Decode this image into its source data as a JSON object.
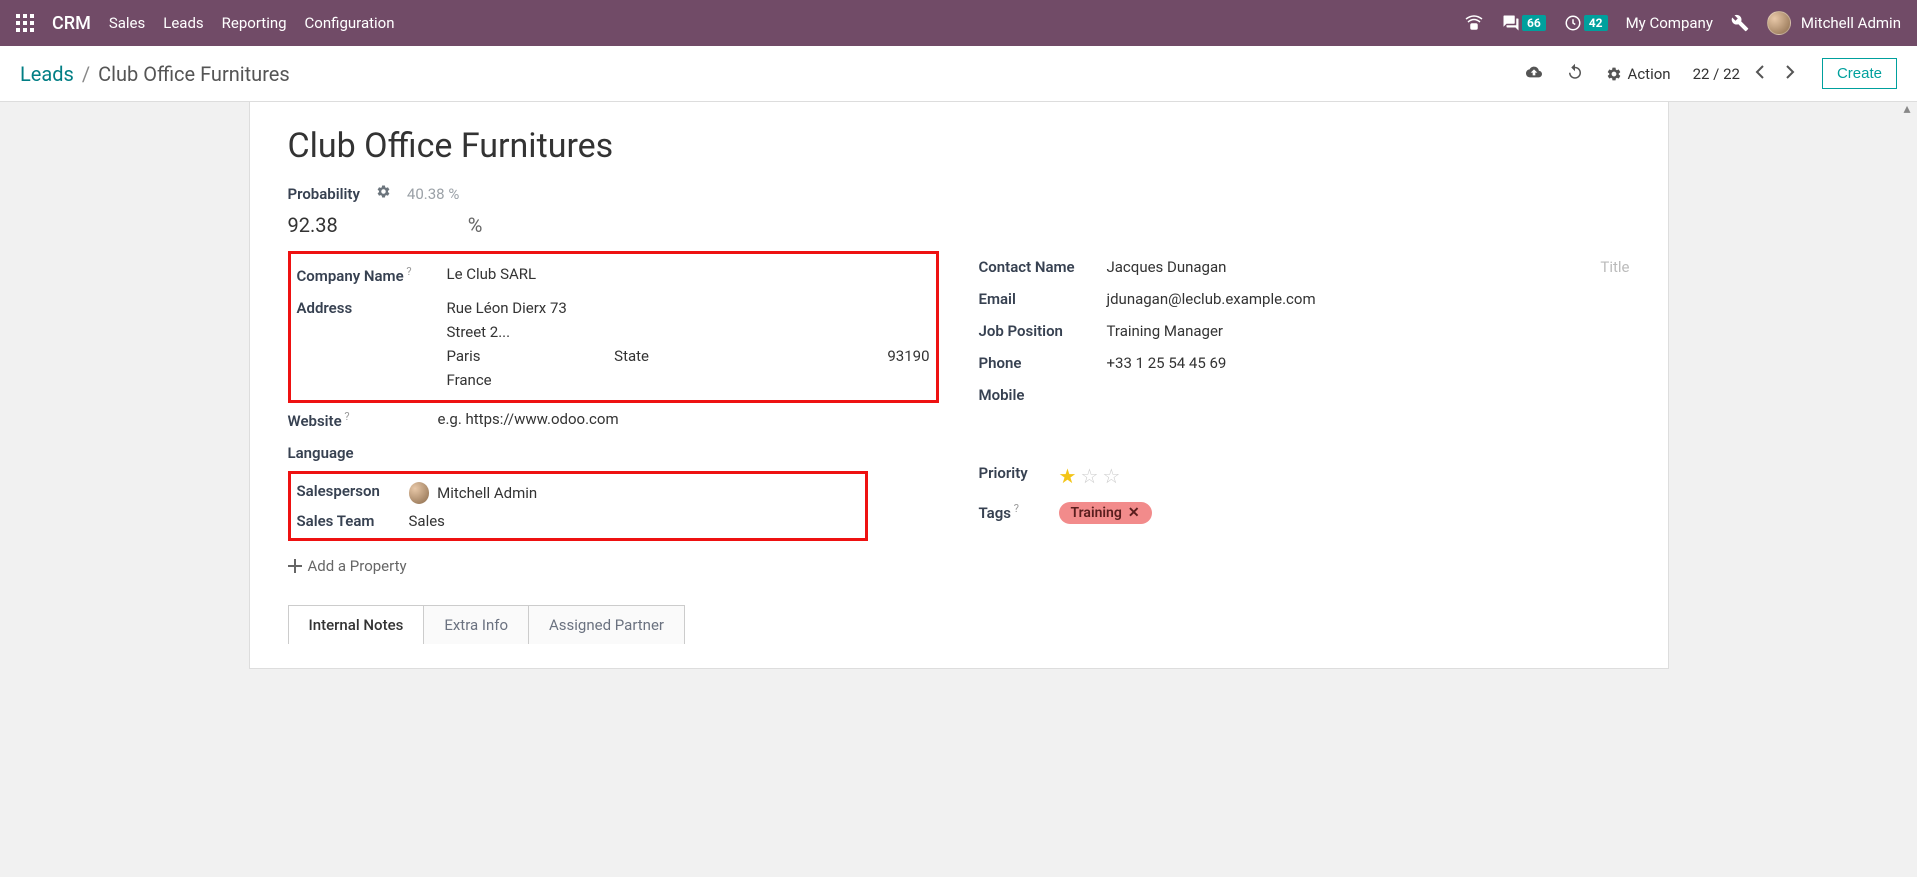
{
  "navbar": {
    "brand": "CRM",
    "menu": [
      "Sales",
      "Leads",
      "Reporting",
      "Configuration"
    ],
    "messages_badge": "66",
    "activities_badge": "42",
    "company_name": "My Company",
    "user_name": "Mitchell Admin"
  },
  "actionbar": {
    "breadcrumb_root": "Leads",
    "breadcrumb_current": "Club Office Furnitures",
    "action_label": "Action",
    "pager_current": "22",
    "pager_total": "22",
    "create_label": "Create"
  },
  "lead": {
    "title": "Club Office Furnitures",
    "probability_label": "Probability",
    "probability_hint": "40.38 %",
    "probability_value": "92.38",
    "percent": "%",
    "company_name_label": "Company Name",
    "company_name_value": "Le Club SARL",
    "address_label": "Address",
    "street": "Rue Léon Dierx 73",
    "street2_placeholder": "Street 2...",
    "city": "Paris",
    "state_placeholder": "State",
    "zip": "93190",
    "country": "France",
    "website_label": "Website",
    "website_placeholder": "e.g. https://www.odoo.com",
    "language_label": "Language",
    "salesperson_label": "Salesperson",
    "salesperson_value": "Mitchell Admin",
    "salesteam_label": "Sales Team",
    "salesteam_value": "Sales",
    "add_property_label": "Add a Property",
    "contact_name_label": "Contact Name",
    "contact_name_value": "Jacques Dunagan",
    "title_placeholder": "Title",
    "email_label": "Email",
    "email_value": "jdunagan@leclub.example.com",
    "job_label": "Job Position",
    "job_value": "Training Manager",
    "phone_label": "Phone",
    "phone_value": "+33 1 25 54 45 69",
    "mobile_label": "Mobile",
    "priority_label": "Priority",
    "tags_label": "Tags",
    "tag_value": "Training"
  },
  "tabs": {
    "internal_notes": "Internal Notes",
    "extra_info": "Extra Info",
    "assigned_partner": "Assigned Partner"
  }
}
